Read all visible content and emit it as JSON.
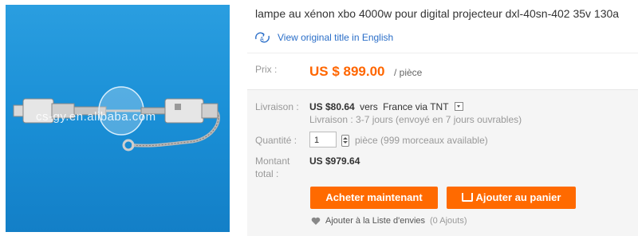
{
  "product": {
    "title": "lampe au xénon xbo 4000w pour digital projecteur dxl-40sn-402 35v 130a",
    "translate_link": "View original title in English",
    "image_watermark": "cs-gy.en.alibaba.com"
  },
  "price": {
    "label": "Prix :",
    "amount": "US $ 899.00",
    "unit": "/ pièce"
  },
  "shipping": {
    "label": "Livraison :",
    "cost": "US $80.64",
    "to_text": "vers",
    "destination": "France via TNT",
    "time": "Livraison : 3-7 jours (envoyé en 7 jours ouvrables)"
  },
  "quantity": {
    "label": "Quantité :",
    "value": "1",
    "availability": "pièce (999 morceaux available)"
  },
  "total": {
    "label_line1": "Montant",
    "label_line2": "total :",
    "amount": "US $979.64"
  },
  "actions": {
    "buy_now": "Acheter maintenant",
    "add_to_cart": "Ajouter au panier",
    "wishlist": "Ajouter à la Liste d'envies",
    "wishlist_count": "(0 Ajouts)"
  },
  "colors": {
    "accent": "#ff6a00",
    "link": "#2a6ec8",
    "price": "#ff6600",
    "photo_bg": "#1a8fd6"
  }
}
